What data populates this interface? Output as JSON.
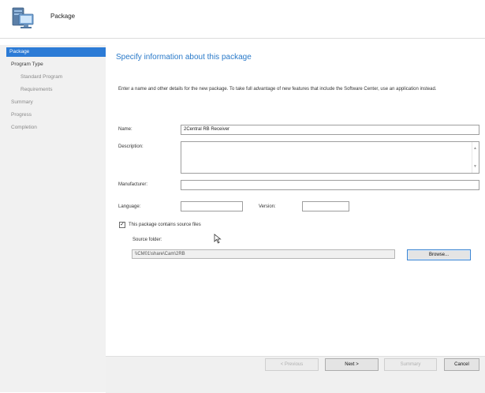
{
  "window": {
    "title": "Package"
  },
  "sidebar": {
    "items": [
      {
        "label": "Package"
      },
      {
        "label": "Program Type"
      },
      {
        "label": "Standard Program"
      },
      {
        "label": "Requirements"
      },
      {
        "label": "Summary"
      },
      {
        "label": "Progress"
      },
      {
        "label": "Completion"
      }
    ]
  },
  "main": {
    "heading": "Specify information about this package",
    "intro": "Enter a name and other details for the new package. To take full advantage of new features that include the Software Center, use an application instead.",
    "name": {
      "label": "Name:",
      "value": "2Central RB Receiver"
    },
    "description": {
      "label": "Description:",
      "value": ""
    },
    "manufacturer": {
      "label": "Manufacturer:",
      "value": ""
    },
    "language": {
      "label": "Language:",
      "value": ""
    },
    "version": {
      "label": "Version:",
      "value": ""
    },
    "source_files_checkbox": {
      "label": "This package contains source files",
      "checked": true,
      "mark": "✓"
    },
    "source_folder": {
      "label": "Source folder:",
      "value": "\\\\CM01\\share\\Cam\\2RB"
    },
    "browse_label": "Browse..."
  },
  "footer": {
    "previous_label": "< Previous",
    "next_label": "Next >",
    "summary_label": "Summary",
    "cancel_label": "Cancel"
  },
  "colors": {
    "accent": "#2c7bd6",
    "heading": "#2a7ac9",
    "sidebar_bg": "#f1f1f1",
    "footer_bg": "#f0f0f0"
  },
  "icons": {
    "header": "computer-package-icon",
    "cursor": "mouse-cursor-icon",
    "scroll_up": "scroll-up-icon",
    "scroll_down": "scroll-down-icon"
  }
}
